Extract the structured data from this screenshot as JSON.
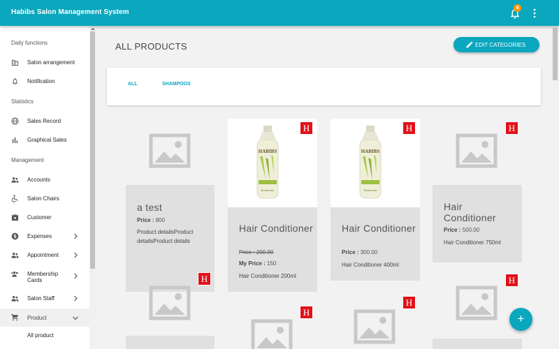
{
  "app": {
    "title": "Habibs Salon Management System",
    "notification_count": "4"
  },
  "sidebar": {
    "sections": [
      "Daily functions",
      "Statistics",
      "Management"
    ],
    "items": [
      {
        "label": "Salon arrangement",
        "icon": "building-icon"
      },
      {
        "label": "Notification",
        "icon": "bell-icon"
      },
      {
        "label": "Sales Record",
        "icon": "globe-icon"
      },
      {
        "label": "Graphical Sales",
        "icon": "bar-chart-icon"
      },
      {
        "label": "Accounts",
        "icon": "people-icon"
      },
      {
        "label": "Salon Chairs",
        "icon": "wheelchair-icon"
      },
      {
        "label": "Customer",
        "icon": "briefcase-icon"
      },
      {
        "label": "Expenses",
        "icon": "dollar-icon"
      },
      {
        "label": "Appointment",
        "icon": "people-icon"
      },
      {
        "label": "Membership Cards",
        "icon": "people-plus-icon"
      },
      {
        "label": "Salon Staff",
        "icon": "people-icon"
      },
      {
        "label": "Product",
        "icon": "cart-icon"
      }
    ],
    "sub_items": [
      "All product"
    ]
  },
  "main": {
    "title": "ALL PRODUCTS",
    "edit_button": "EDIT CATEGORIES",
    "tabs": [
      "ALL",
      "SHAMPOOS"
    ]
  },
  "products": [
    {
      "name": "a test",
      "price_label": "Price :",
      "price": "800",
      "description": "Product detailsProduct detailsProduct details",
      "badge": "H"
    },
    {
      "name": "Hair Conditioner",
      "price_label": "Price :",
      "price": "200.00",
      "my_price_label": "My Price :",
      "my_price": "150",
      "description": "Hair Conditioner 200ml",
      "badge": "H"
    },
    {
      "name": "Hair Conditioner",
      "price_label": "Price :",
      "price": "300.00",
      "description": "Hair Conditioner 400ml",
      "badge": "H"
    },
    {
      "name": "Hair Conditioner",
      "price_label": "Price :",
      "price": "500.00",
      "description": "Hair Conditioner 750ml",
      "badge": "H"
    },
    {
      "badge": "H"
    },
    {
      "badge": "H"
    },
    {
      "badge": "H"
    },
    {
      "badge": "H"
    }
  ],
  "bottle": {
    "brand": "HABIBS",
    "sub": "Botanicals"
  },
  "fab": {
    "label": "+"
  },
  "colors": {
    "primary": "#0aa7be",
    "badge_red": "#e0121a",
    "notification": "#ff9800"
  }
}
